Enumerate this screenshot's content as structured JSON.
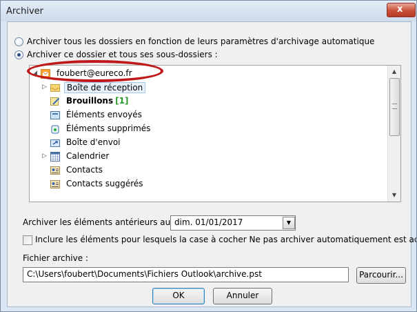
{
  "window": {
    "title": "Archiver",
    "close_glyph": "x"
  },
  "options": {
    "archive_all_label": "Archiver tous les dossiers en fonction de leurs paramètres d'archivage automatique",
    "archive_folder_label": "Archiver ce dossier et tous ses sous-dossiers :"
  },
  "tree": {
    "root": "foubert@eureco.fr",
    "items": [
      {
        "label": "Boîte de réception",
        "icon": "inbox-icon",
        "expandable": true,
        "selected": true
      },
      {
        "label": "Brouillons",
        "count": "[1]",
        "icon": "drafts-icon",
        "bold": true
      },
      {
        "label": "Éléments envoyés",
        "icon": "sent-items-icon"
      },
      {
        "label": "Éléments supprimés",
        "icon": "deleted-items-icon"
      },
      {
        "label": "Boîte d'envoi",
        "icon": "outbox-icon"
      },
      {
        "label": "Calendrier",
        "icon": "calendar-icon",
        "expandable": true
      },
      {
        "label": "Contacts",
        "icon": "contacts-icon"
      },
      {
        "label": "Contacts suggérés",
        "icon": "suggested-contacts-icon"
      }
    ]
  },
  "older_items": {
    "label": "Archiver les éléments antérieurs au :",
    "date_value": "dim. 01/01/2017"
  },
  "include_checkbox": {
    "label": "Inclure les éléments pour lesquels la case à cocher Ne pas archiver automatiquement est activée",
    "checked": false
  },
  "archive_file": {
    "label": "Fichier archive :",
    "path": "C:\\Users\\foubert\\Documents\\Fichiers Outlook\\archive.pst"
  },
  "buttons": {
    "browse": "Parcourir...",
    "ok": "OK",
    "cancel": "Annuler"
  },
  "colors": {
    "highlight_ring": "#c0191b",
    "count_green": "#2a9a2a",
    "close_button": "#c9513c"
  }
}
